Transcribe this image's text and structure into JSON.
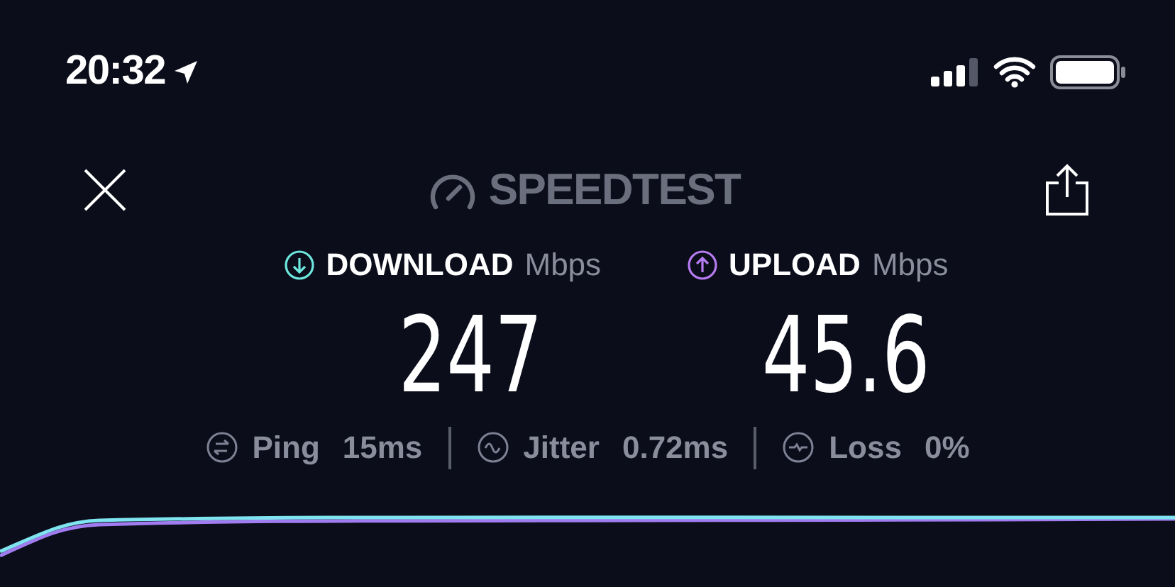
{
  "status_bar": {
    "time": "20:32"
  },
  "header": {
    "title": "SPEEDTEST"
  },
  "results": [
    {
      "kind": "download",
      "label": "DOWNLOAD",
      "unit": "Mbps",
      "value": "247"
    },
    {
      "kind": "upload",
      "label": "UPLOAD",
      "unit": "Mbps",
      "value": "45.6"
    }
  ],
  "stats": [
    {
      "kind": "ping",
      "label": "Ping",
      "value": "15",
      "unit": "ms"
    },
    {
      "kind": "jitter",
      "label": "Jitter",
      "value": "0.72",
      "unit": "ms"
    },
    {
      "kind": "loss",
      "label": "Loss",
      "value": "0",
      "unit": "%"
    }
  ]
}
